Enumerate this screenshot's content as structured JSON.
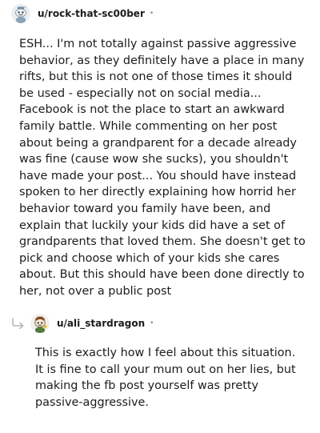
{
  "comments": [
    {
      "username": "u/rock-that-sc00ber",
      "separator": "•",
      "avatar_icon": "reddit-snoo-avatar-icon",
      "body": "ESH... I'm not totally against passive aggressive behavior, as they definitely have a place in many rifts, but this is not one of those times it should be used - especially not on social media... Facebook is not the place to start an awkward family battle. While commenting on her post about being a grandparent for a decade already was fine (cause wow she sucks), you shouldn't have made your post... You should have instead spoken to her directly explaining how horrid her behavior toward you family have been, and explain that luckily your kids did have a set of grandparents that loved them. She doesn't get to pick and choose which of your kids she cares about. But this should have been done directly to her, not over a public post"
    },
    {
      "username": "u/ali_stardragon",
      "separator": "•",
      "avatar_icon": "reddit-snoo-avatar-icon",
      "reply_icon": "reply-arrow-icon",
      "body": "This is exactly how I feel about this situation. It is fine to call your mum out on her lies, but making the fb post yourself was pretty passive-aggressive."
    }
  ],
  "colors": {
    "text": "#1c1c1c",
    "meta": "#878a8c",
    "reply_arrow": "#b5b8ba"
  }
}
